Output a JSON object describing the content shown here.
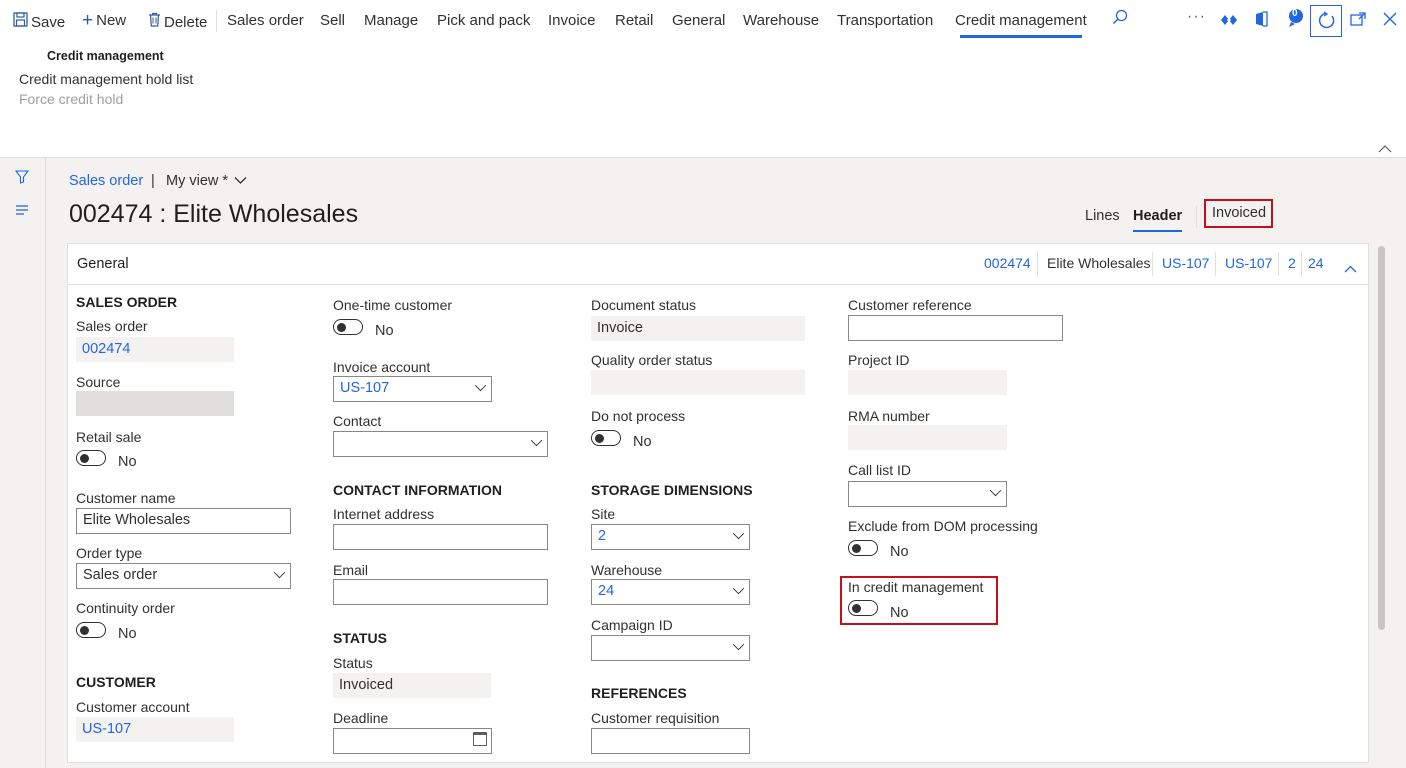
{
  "actionbar": {
    "save": "Save",
    "new": "New",
    "delete": "Delete",
    "tabs": [
      "Sales order",
      "Sell",
      "Manage",
      "Pick and pack",
      "Invoice",
      "Retail",
      "General",
      "Warehouse",
      "Transportation",
      "Credit management"
    ],
    "active_tab": "Credit management",
    "icons": {
      "save": "save-icon",
      "new": "plus-icon",
      "delete": "trash-icon",
      "search": "search-icon",
      "more": "more-icon",
      "power_apps": "diamond-icon",
      "office": "office-icon",
      "notifications": "notification-icon",
      "notification_count": "0",
      "refresh": "refresh-icon",
      "open_new": "open-in-new-window-icon",
      "close": "close-icon"
    }
  },
  "ribbon": {
    "group_title": "Credit management",
    "items": [
      "Credit management hold list",
      "Force credit hold"
    ]
  },
  "page": {
    "breadcrumb": "Sales order",
    "view": "My view *",
    "title": "002474 : Elite Wholesales",
    "view_tabs": [
      "Lines",
      "Header"
    ],
    "active_view_tab": "Header",
    "status": "Invoiced"
  },
  "card": {
    "title": "General",
    "summary": [
      "002474",
      "Elite Wholesales",
      "US-107",
      "US-107",
      "2",
      "24"
    ]
  },
  "col1": {
    "section": "SALES ORDER",
    "sales_order_label": "Sales order",
    "sales_order_value": "002474",
    "source_label": "Source",
    "source_value": "",
    "retail_sale_label": "Retail sale",
    "retail_sale_value": "No",
    "customer_name_label": "Customer name",
    "customer_name_value": "Elite Wholesales",
    "order_type_label": "Order type",
    "order_type_value": "Sales order",
    "continuity_label": "Continuity order",
    "continuity_value": "No",
    "customer_section": "CUSTOMER",
    "customer_account_label": "Customer account",
    "customer_account_value": "US-107"
  },
  "col2": {
    "one_time_label": "One-time customer",
    "one_time_value": "No",
    "invoice_account_label": "Invoice account",
    "invoice_account_value": "US-107",
    "contact_label": "Contact",
    "contact_value": "",
    "contact_section": "CONTACT INFORMATION",
    "internet_label": "Internet address",
    "internet_value": "",
    "email_label": "Email",
    "email_value": "",
    "status_section": "STATUS",
    "status_label": "Status",
    "status_value": "Invoiced",
    "deadline_label": "Deadline",
    "deadline_value": ""
  },
  "col3": {
    "doc_status_label": "Document status",
    "doc_status_value": "Invoice",
    "quality_label": "Quality order status",
    "quality_value": "",
    "do_not_process_label": "Do not process",
    "do_not_process_value": "No",
    "storage_section": "STORAGE DIMENSIONS",
    "site_label": "Site",
    "site_value": "2",
    "warehouse_label": "Warehouse",
    "warehouse_value": "24",
    "campaign_label": "Campaign ID",
    "campaign_value": "",
    "references_section": "REFERENCES",
    "customer_requisition_label": "Customer requisition",
    "customer_requisition_value": ""
  },
  "col4": {
    "customer_reference_label": "Customer reference",
    "customer_reference_value": "",
    "project_label": "Project ID",
    "project_value": "",
    "rma_label": "RMA number",
    "rma_value": "",
    "call_list_label": "Call list ID",
    "call_list_value": "",
    "exclude_dom_label": "Exclude from DOM processing",
    "exclude_dom_value": "No",
    "credit_mgmt_label": "In credit management",
    "credit_mgmt_value": "No"
  },
  "colors": {
    "accent": "#2266e3",
    "highlight": "#c50f1f"
  }
}
